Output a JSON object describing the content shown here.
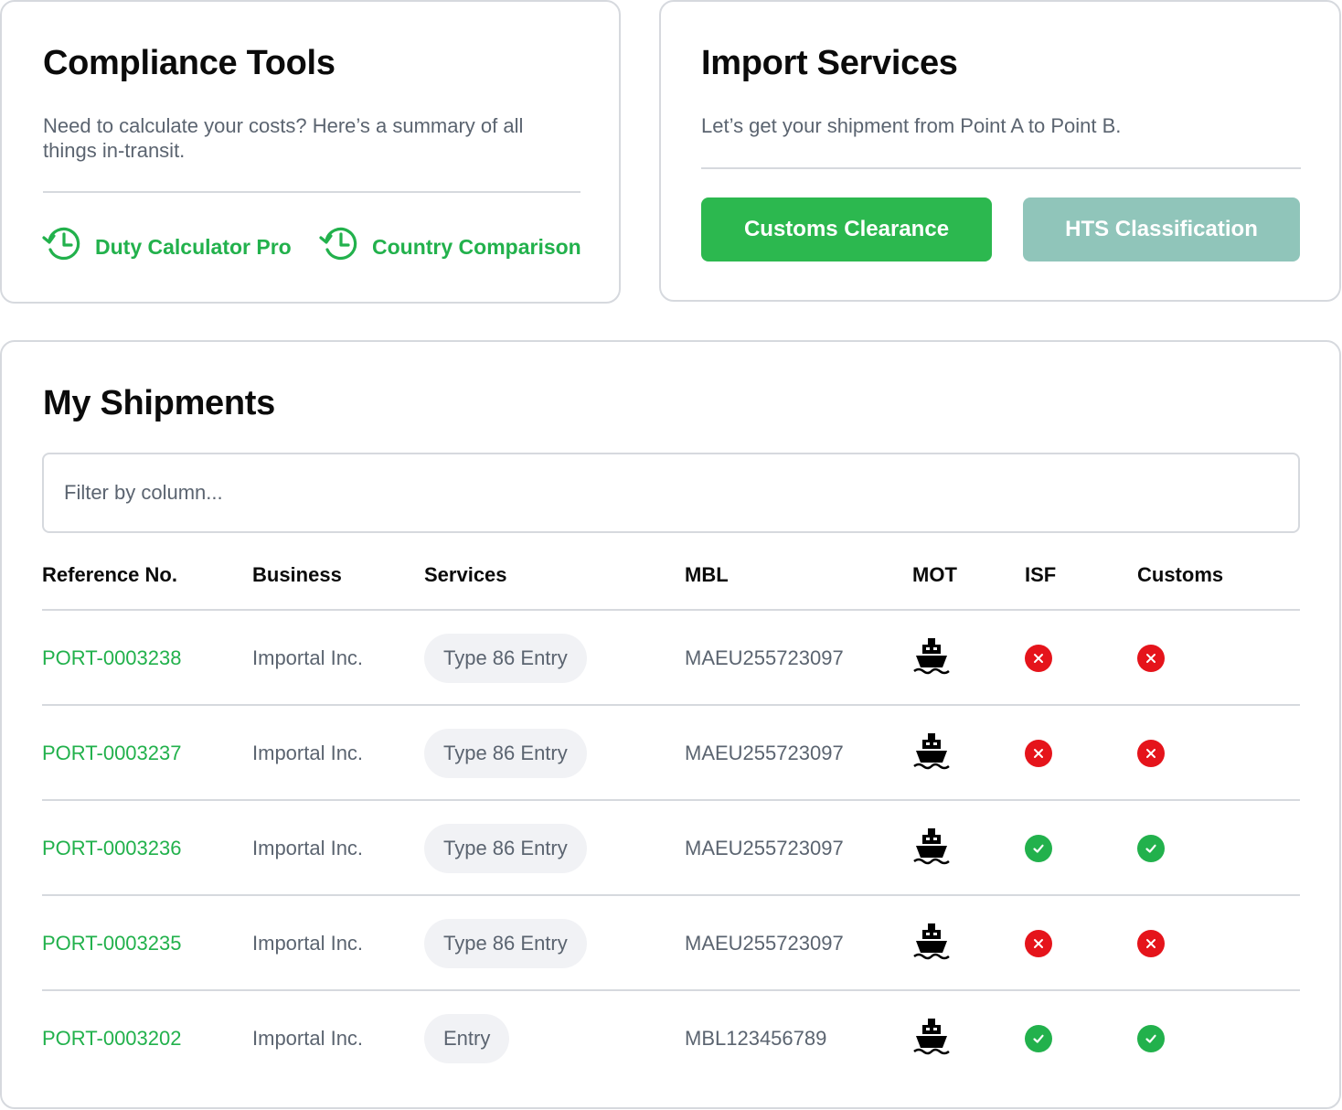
{
  "compliance": {
    "title": "Compliance Tools",
    "description": "Need to calculate your costs? Here’s a summary of all things in-transit.",
    "links": [
      {
        "label": "Duty Calculator Pro",
        "icon": "history-clock-icon"
      },
      {
        "label": "Country Comparison",
        "icon": "history-clock-icon"
      }
    ]
  },
  "import": {
    "title": "Import Services",
    "description": "Let’s get your shipment from Point A to Point B.",
    "buttons": [
      {
        "label": "Customs Clearance",
        "color": "#2cb84f"
      },
      {
        "label": "HTS Classification",
        "color": "#90c5ba"
      }
    ]
  },
  "shipments": {
    "title": "My Shipments",
    "filter_placeholder": "Filter by column...",
    "columns": [
      "Reference No.",
      "Business",
      "Services",
      "MBL",
      "MOT",
      "ISF",
      "Customs"
    ],
    "rows": [
      {
        "ref": "PORT-0003238",
        "business": "Importal Inc.",
        "service": "Type 86 Entry",
        "mbl": "MAEU255723097",
        "mot": "ship-icon",
        "isf": "failed",
        "customs": "failed"
      },
      {
        "ref": "PORT-0003237",
        "business": "Importal Inc.",
        "service": "Type 86 Entry",
        "mbl": "MAEU255723097",
        "mot": "ship-icon",
        "isf": "failed",
        "customs": "failed"
      },
      {
        "ref": "PORT-0003236",
        "business": "Importal Inc.",
        "service": "Type 86 Entry",
        "mbl": "MAEU255723097",
        "mot": "ship-icon",
        "isf": "passed",
        "customs": "passed"
      },
      {
        "ref": "PORT-0003235",
        "business": "Importal Inc.",
        "service": "Type 86 Entry",
        "mbl": "MAEU255723097",
        "mot": "ship-icon",
        "isf": "failed",
        "customs": "failed"
      },
      {
        "ref": "PORT-0003202",
        "business": "Importal Inc.",
        "service": "Entry",
        "mbl": "MBL123456789",
        "mot": "ship-icon",
        "isf": "passed",
        "customs": "passed"
      }
    ]
  },
  "colors": {
    "accent_green": "#22b14c",
    "button_green": "#2cb84f",
    "button_teal": "#90c5ba",
    "status_failed": "#e5141b",
    "status_passed": "#22b14c"
  }
}
